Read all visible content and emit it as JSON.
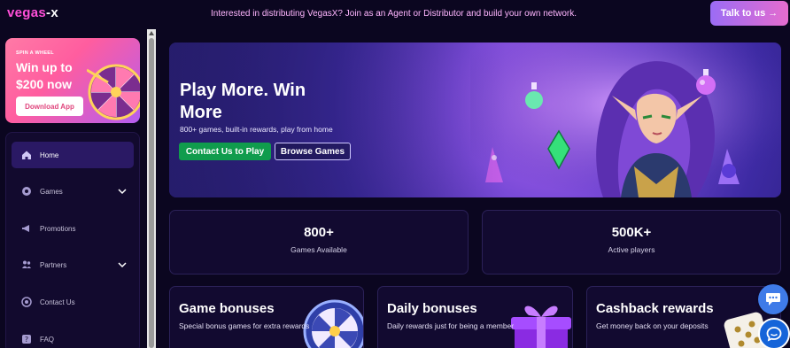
{
  "header": {
    "logo_part1": "vegas",
    "logo_part2": "-x",
    "announcement": "Interested in distributing VegasX? Join as an Agent or Distributor and build your own network.",
    "talk_button": "Talk to us →"
  },
  "promo": {
    "small_label": "SPIN A WHEEL",
    "title": "Win up to $200 now",
    "download_button": "Download App"
  },
  "sidebar": {
    "items": [
      {
        "label": "Home",
        "icon": "home-icon",
        "active": true,
        "expandable": false
      },
      {
        "label": "Games",
        "icon": "games-icon",
        "active": false,
        "expandable": true
      },
      {
        "label": "Promotions",
        "icon": "megaphone-icon",
        "active": false,
        "expandable": false
      },
      {
        "label": "Partners",
        "icon": "partners-icon",
        "active": false,
        "expandable": true
      },
      {
        "label": "Contact Us",
        "icon": "contact-icon",
        "active": false,
        "expandable": false
      },
      {
        "label": "FAQ",
        "icon": "faq-icon",
        "active": false,
        "expandable": false
      }
    ]
  },
  "hero": {
    "title": "Play More. Win More",
    "subtitle": "800+ games, built-in rewards, play from home",
    "primary_button": "Contact Us to Play",
    "secondary_button": "Browse Games"
  },
  "stats": [
    {
      "value": "800+",
      "label": "Games Available"
    },
    {
      "value": "500K+",
      "label": "Active players"
    }
  ],
  "features": [
    {
      "title": "Game bonuses",
      "description": "Special bonus games for extra rewards"
    },
    {
      "title": "Daily bonuses",
      "description": "Daily rewards just for being a member"
    },
    {
      "title": "Cashback rewards",
      "description": "Get money back on your deposits"
    }
  ],
  "colors": {
    "background": "#0b0620",
    "accent_pink": "#ff4fd8",
    "primary_green": "#109c4d",
    "card_bg": "#120a30"
  }
}
